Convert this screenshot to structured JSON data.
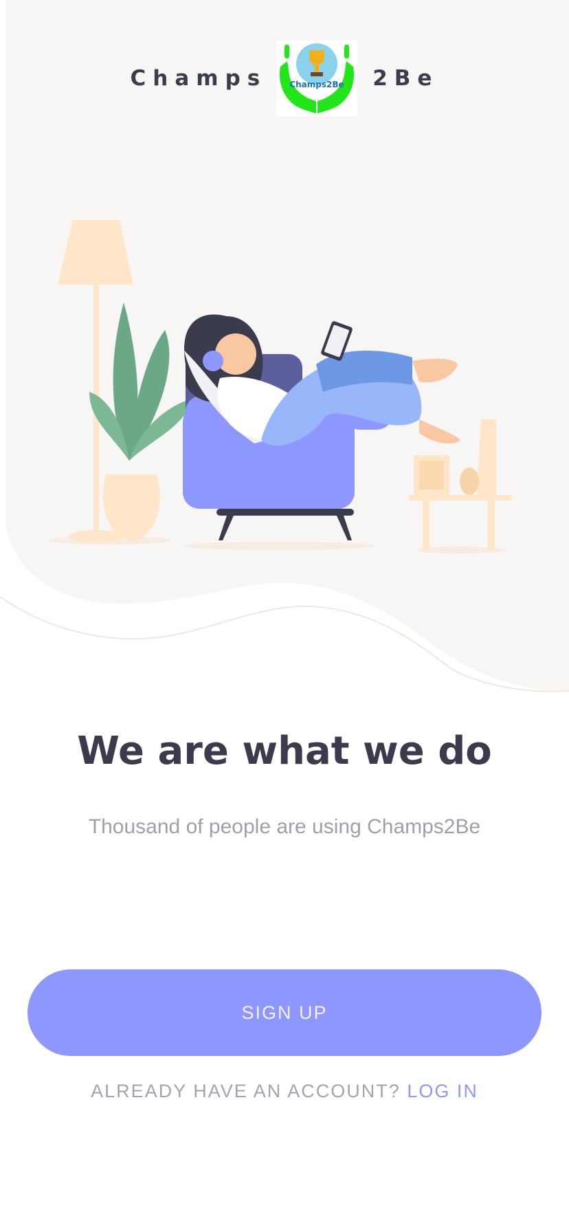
{
  "brand": {
    "left": "Champs",
    "right": "2Be",
    "logo_text": "Champs2Be"
  },
  "main": {
    "headline": "We are what we do",
    "subtitle": "Thousand of people are using Champs2Be"
  },
  "actions": {
    "signup_label": "SIGN UP",
    "login_prompt": "ALREADY HAVE AN ACCOUNT?",
    "login_link": "LOG IN"
  },
  "colors": {
    "accent": "#8e97fd",
    "headline": "#3a3b4c",
    "muted": "#a1a4b2",
    "hero_bg": "#f8f6f4",
    "logo_green": "#22e61a"
  },
  "icons": [
    "champs2be-logo",
    "woman-on-armchair-illustration"
  ]
}
